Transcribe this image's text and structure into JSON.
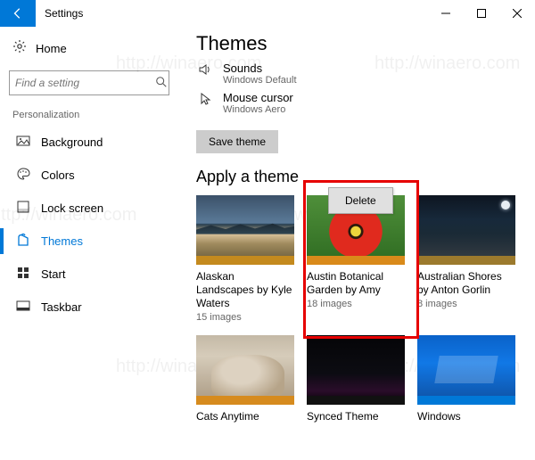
{
  "window": {
    "title": "Settings"
  },
  "sidebar": {
    "home": "Home",
    "search_placeholder": "Find a setting",
    "section": "Personalization",
    "items": [
      {
        "label": "Background"
      },
      {
        "label": "Colors"
      },
      {
        "label": "Lock screen"
      },
      {
        "label": "Themes"
      },
      {
        "label": "Start"
      },
      {
        "label": "Taskbar"
      }
    ]
  },
  "content": {
    "heading": "Themes",
    "sounds": {
      "label": "Sounds",
      "value": "Windows Default"
    },
    "cursor": {
      "label": "Mouse cursor",
      "value": "Windows Aero"
    },
    "save_btn": "Save theme",
    "apply_label": "Apply a theme",
    "delete_label": "Delete",
    "themes": [
      {
        "title": "Alaskan Landscapes by Kyle Waters",
        "sub": "15 images",
        "swatch": "#c48a1e",
        "art": "alaskan"
      },
      {
        "title": "Austin Botanical Garden by Amy",
        "sub": "18 images",
        "swatch": "#d98a1a",
        "art": "austin"
      },
      {
        "title": "Australian Shores by Anton Gorlin",
        "sub": "8 images",
        "swatch": "#9c7a2d",
        "art": "australian"
      },
      {
        "title": "Cats Anytime",
        "sub": "",
        "swatch": "#d68b1e",
        "art": "cats"
      },
      {
        "title": "Synced Theme",
        "sub": "",
        "swatch": "#111111",
        "art": "synced"
      },
      {
        "title": "Windows",
        "sub": "",
        "swatch": "#0078d7",
        "art": "windows"
      }
    ]
  },
  "watermark": "http://winaero.com"
}
